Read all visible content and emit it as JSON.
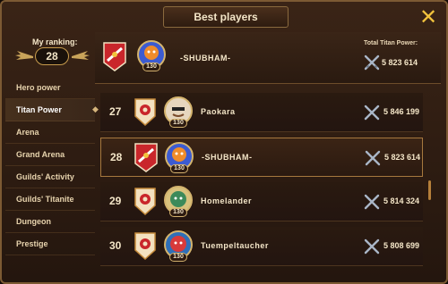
{
  "window": {
    "title": "Best players"
  },
  "sidebar": {
    "ranking_label": "My ranking:",
    "ranking_value": "28",
    "items": [
      {
        "label": "Hero power"
      },
      {
        "label": "Titan Power"
      },
      {
        "label": "Arena"
      },
      {
        "label": "Grand Arena"
      },
      {
        "label": "Guilds' Activity"
      },
      {
        "label": "Guilds' Titanite"
      },
      {
        "label": "Dungeon"
      },
      {
        "label": "Prestige"
      }
    ],
    "active_index": 1
  },
  "header": {
    "player_name": "-SHUBHAM-",
    "avatar_level": "130",
    "total_label": "Total Titan Power:",
    "total_value": "5 823 614"
  },
  "rows": [
    {
      "rank": "27",
      "name": "Paokara",
      "level": "130",
      "power": "5 846 199",
      "banner": "shield",
      "avatar": "hero-shades"
    },
    {
      "rank": "28",
      "name": "-SHUBHAM-",
      "level": "130",
      "power": "5 823 614",
      "banner": "red",
      "avatar": "titan-fire"
    },
    {
      "rank": "29",
      "name": "Homelander",
      "level": "130",
      "power": "5 814 324",
      "banner": "shield",
      "avatar": "titan-green"
    },
    {
      "rank": "30",
      "name": "Tuempeltaucher",
      "level": "130",
      "power": "5 808 699",
      "banner": "shield",
      "avatar": "titan-red"
    }
  ],
  "colors": {
    "accent": "#f2c33d",
    "text": "#f4e6c8",
    "panel": "#2a1a10",
    "highlight_border": "#a6783e"
  }
}
